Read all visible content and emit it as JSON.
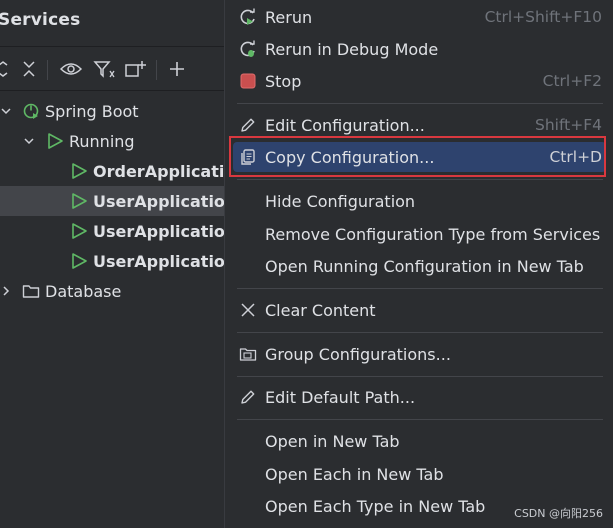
{
  "services": {
    "title": "Services",
    "tree": {
      "spring_boot": "Spring Boot",
      "running": "Running",
      "apps": [
        "OrderApplication",
        "UserApplication",
        "UserApplication",
        "UserApplication"
      ],
      "database": "Database"
    }
  },
  "menu": {
    "rerun": {
      "label": "Rerun",
      "shortcut": "Ctrl+Shift+F10"
    },
    "rerun_debug": {
      "label": "Rerun in Debug Mode"
    },
    "stop": {
      "label": "Stop",
      "shortcut": "Ctrl+F2"
    },
    "edit_config": {
      "label": "Edit Configuration...",
      "shortcut": "Shift+F4"
    },
    "copy_config": {
      "label": "Copy Configuration...",
      "shortcut": "Ctrl+D"
    },
    "hide_config": {
      "label": "Hide Configuration"
    },
    "remove_type": {
      "label": "Remove Configuration Type from Services"
    },
    "open_running": {
      "label": "Open Running Configuration in New Tab"
    },
    "clear_content": {
      "label": "Clear Content"
    },
    "group_configs": {
      "label": "Group Configurations..."
    },
    "edit_default_path": {
      "label": "Edit Default Path..."
    },
    "open_new_tab": {
      "label": "Open in New Tab"
    },
    "open_each": {
      "label": "Open Each in New Tab"
    },
    "open_each_type": {
      "label": "Open Each Type in New Tab"
    }
  },
  "watermark": "CSDN @向阳256",
  "colors": {
    "background": "#2b2d30",
    "selection": "#2e436e",
    "run_green": "#5fb865",
    "stop_red": "#db5c5c",
    "highlight_red": "#d9383f"
  }
}
